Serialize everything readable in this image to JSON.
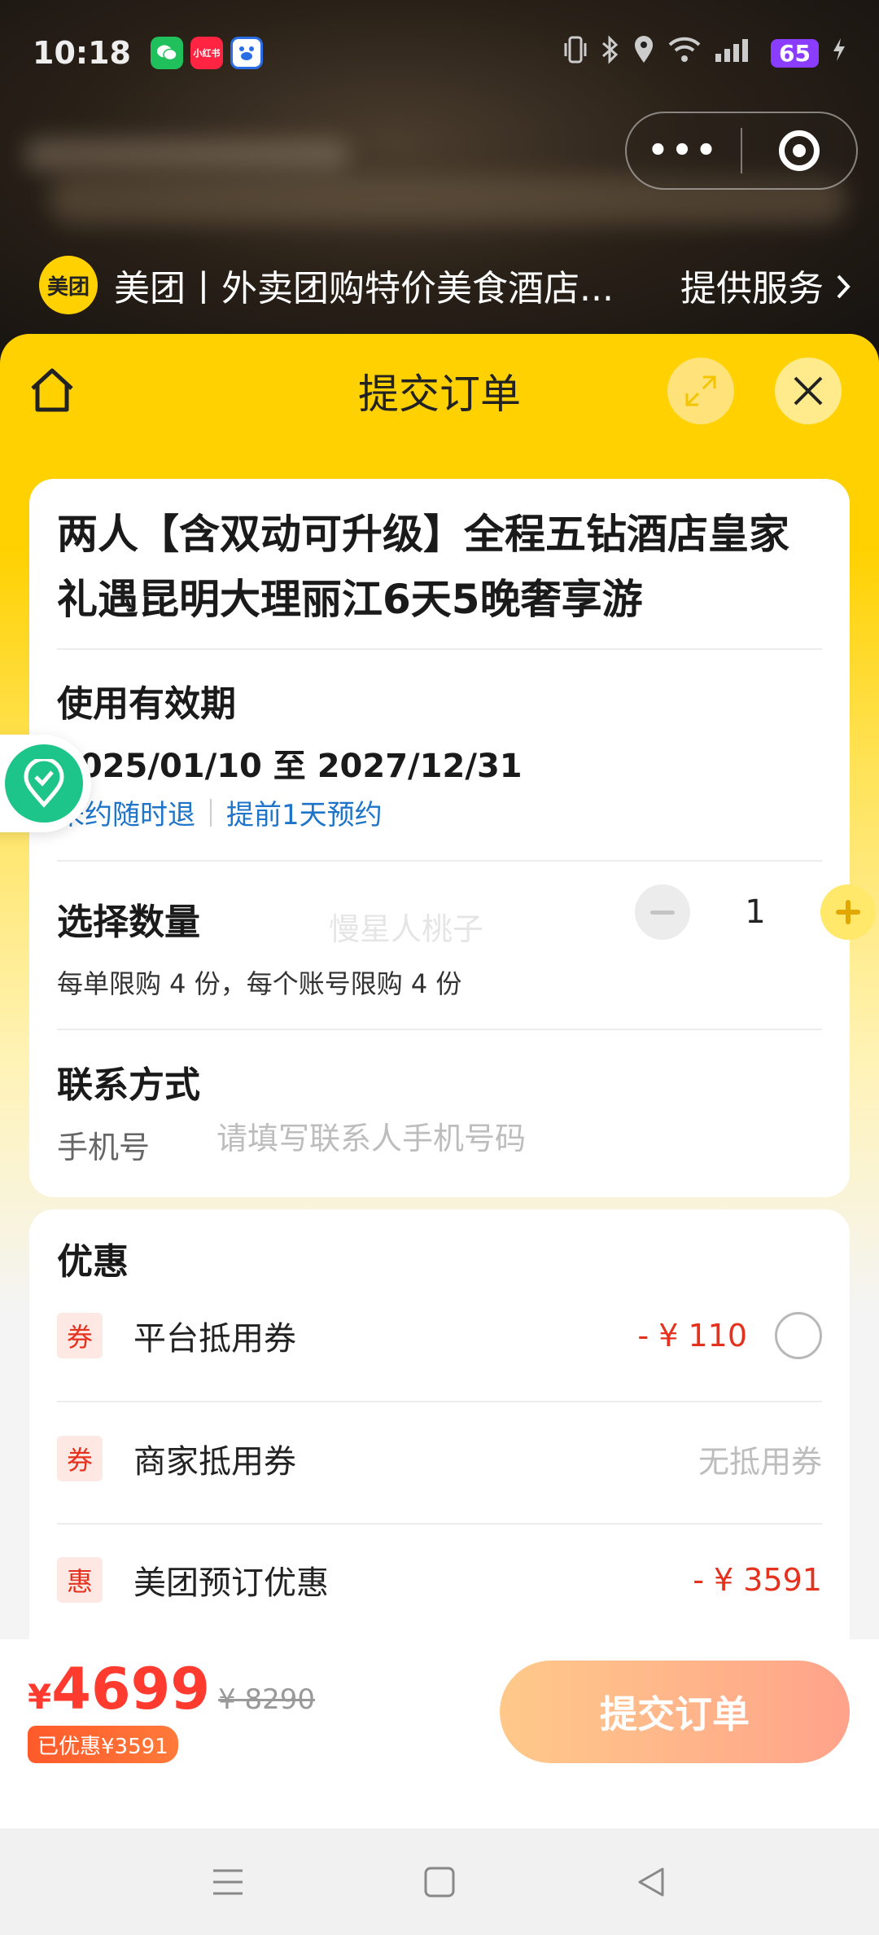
{
  "status_bar": {
    "time": "10:18",
    "app_icons": [
      "wechat-icon",
      "xiaohongshu-icon",
      "baidu-icon"
    ],
    "battery": "65"
  },
  "mini_program": {
    "logo_text": "美团",
    "title": "美团丨外卖团购特价美食酒店...",
    "service_link": "提供服务",
    "capsule_more": "•••"
  },
  "header": {
    "title": "提交订单"
  },
  "product": {
    "title": "两人【含双动可升级】全程五钻酒店皇家礼遇昆明大理丽江6天5晚奢享游",
    "validity_title": "使用有效期",
    "validity_dates": "2025/01/10 至 2027/12/31",
    "tags": [
      "未约随时退",
      "提前1天预约"
    ]
  },
  "quantity": {
    "title": "选择数量",
    "value": "1",
    "limit_text": "每单限购 4 份，每个账号限购 4 份",
    "watermark": "慢星人桃子"
  },
  "contact": {
    "title": "联系方式",
    "phone_label": "手机号",
    "phone_placeholder": "请填写联系人手机号码",
    "phone_value": ""
  },
  "discounts": {
    "title": "优惠",
    "items": [
      {
        "badge": "券",
        "label": "平台抵用券",
        "value": "- ¥ 110",
        "selected": false
      },
      {
        "badge": "券",
        "label": "商家抵用券",
        "value": "无抵用券"
      },
      {
        "badge": "惠",
        "label": "美团预订优惠",
        "value": "- ¥ 3591"
      }
    ]
  },
  "footer": {
    "currency": "¥",
    "price": "4699",
    "original_price": "¥ 8290",
    "saved_badge": "已优惠¥3591",
    "submit_label": "提交订单"
  },
  "colors": {
    "brand_yellow": "#ffd100",
    "price_red": "#ff3b2f",
    "link_blue": "#1d74c9"
  }
}
